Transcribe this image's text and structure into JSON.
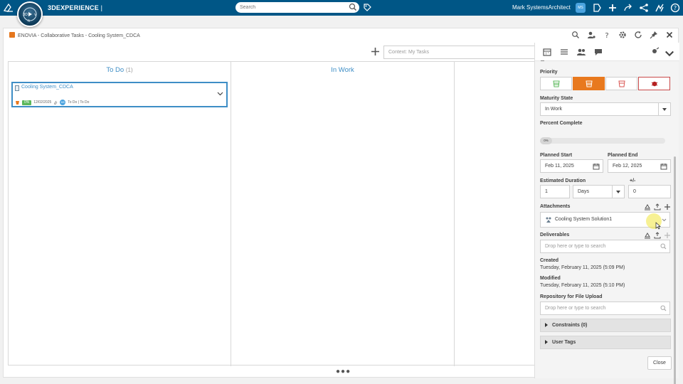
{
  "topbar": {
    "brand_bold": "3DEXPERIENCE",
    "brand_sep": " |",
    "search_placeholder": "Search",
    "user_name": "Mark SystemsArchitect",
    "user_initials": "MS",
    "compass_letters": [
      "3D",
      "V",
      "R"
    ]
  },
  "window": {
    "title": "ENOVIA - Collaborative Tasks - Cooling System_CDCA",
    "context_placeholder": "Context: My Tasks"
  },
  "board": {
    "columns": [
      {
        "title": "To Do",
        "count": "(1)"
      },
      {
        "title": "In Work",
        "count": ""
      }
    ],
    "card": {
      "title": "Cooling System_CDCA",
      "percent": "0%",
      "date": "12/02/2025",
      "assignee_initials": "MS",
      "state_text": "To Do | To Do"
    }
  },
  "panel": {
    "dash": "–",
    "priority_label": "Priority",
    "priority_selected": "high",
    "maturity_label": "Maturity State",
    "maturity_value": "In Work",
    "percent_label": "Percent Complete",
    "percent_value": "0%",
    "percent_fraction": 0,
    "planned_start_label": "Planned Start",
    "planned_start_value": "Feb 11, 2025",
    "planned_end_label": "Planned End",
    "planned_end_value": "Feb 12, 2025",
    "est_duration_label": "Estimated Duration",
    "est_duration_value": "1",
    "duration_unit": "Days",
    "plusminus_label": "+/-",
    "plusminus_value": "0",
    "attachments_label": "Attachments",
    "attachment_item": "Cooling System Solution1",
    "deliverables_label": "Deliverables",
    "deliverables_placeholder": "Drop here or type to search",
    "created_label": "Created",
    "created_value": "Tuesday, February 11, 2025 (5:09 PM)",
    "modified_label": "Modified",
    "modified_value": "Tuesday, February 11, 2025 (5:10 PM)",
    "repo_label": "Repository for File Upload",
    "repo_placeholder": "Drop here or type to search",
    "constraints_label": "Constraints (0)",
    "user_tags_label": "User Tags",
    "close_label": "Close"
  },
  "colors": {
    "topbar": "#005686",
    "accent": "#3e8ec6",
    "priority_high": "#e8791e",
    "percent_green": "#5cb85c"
  }
}
